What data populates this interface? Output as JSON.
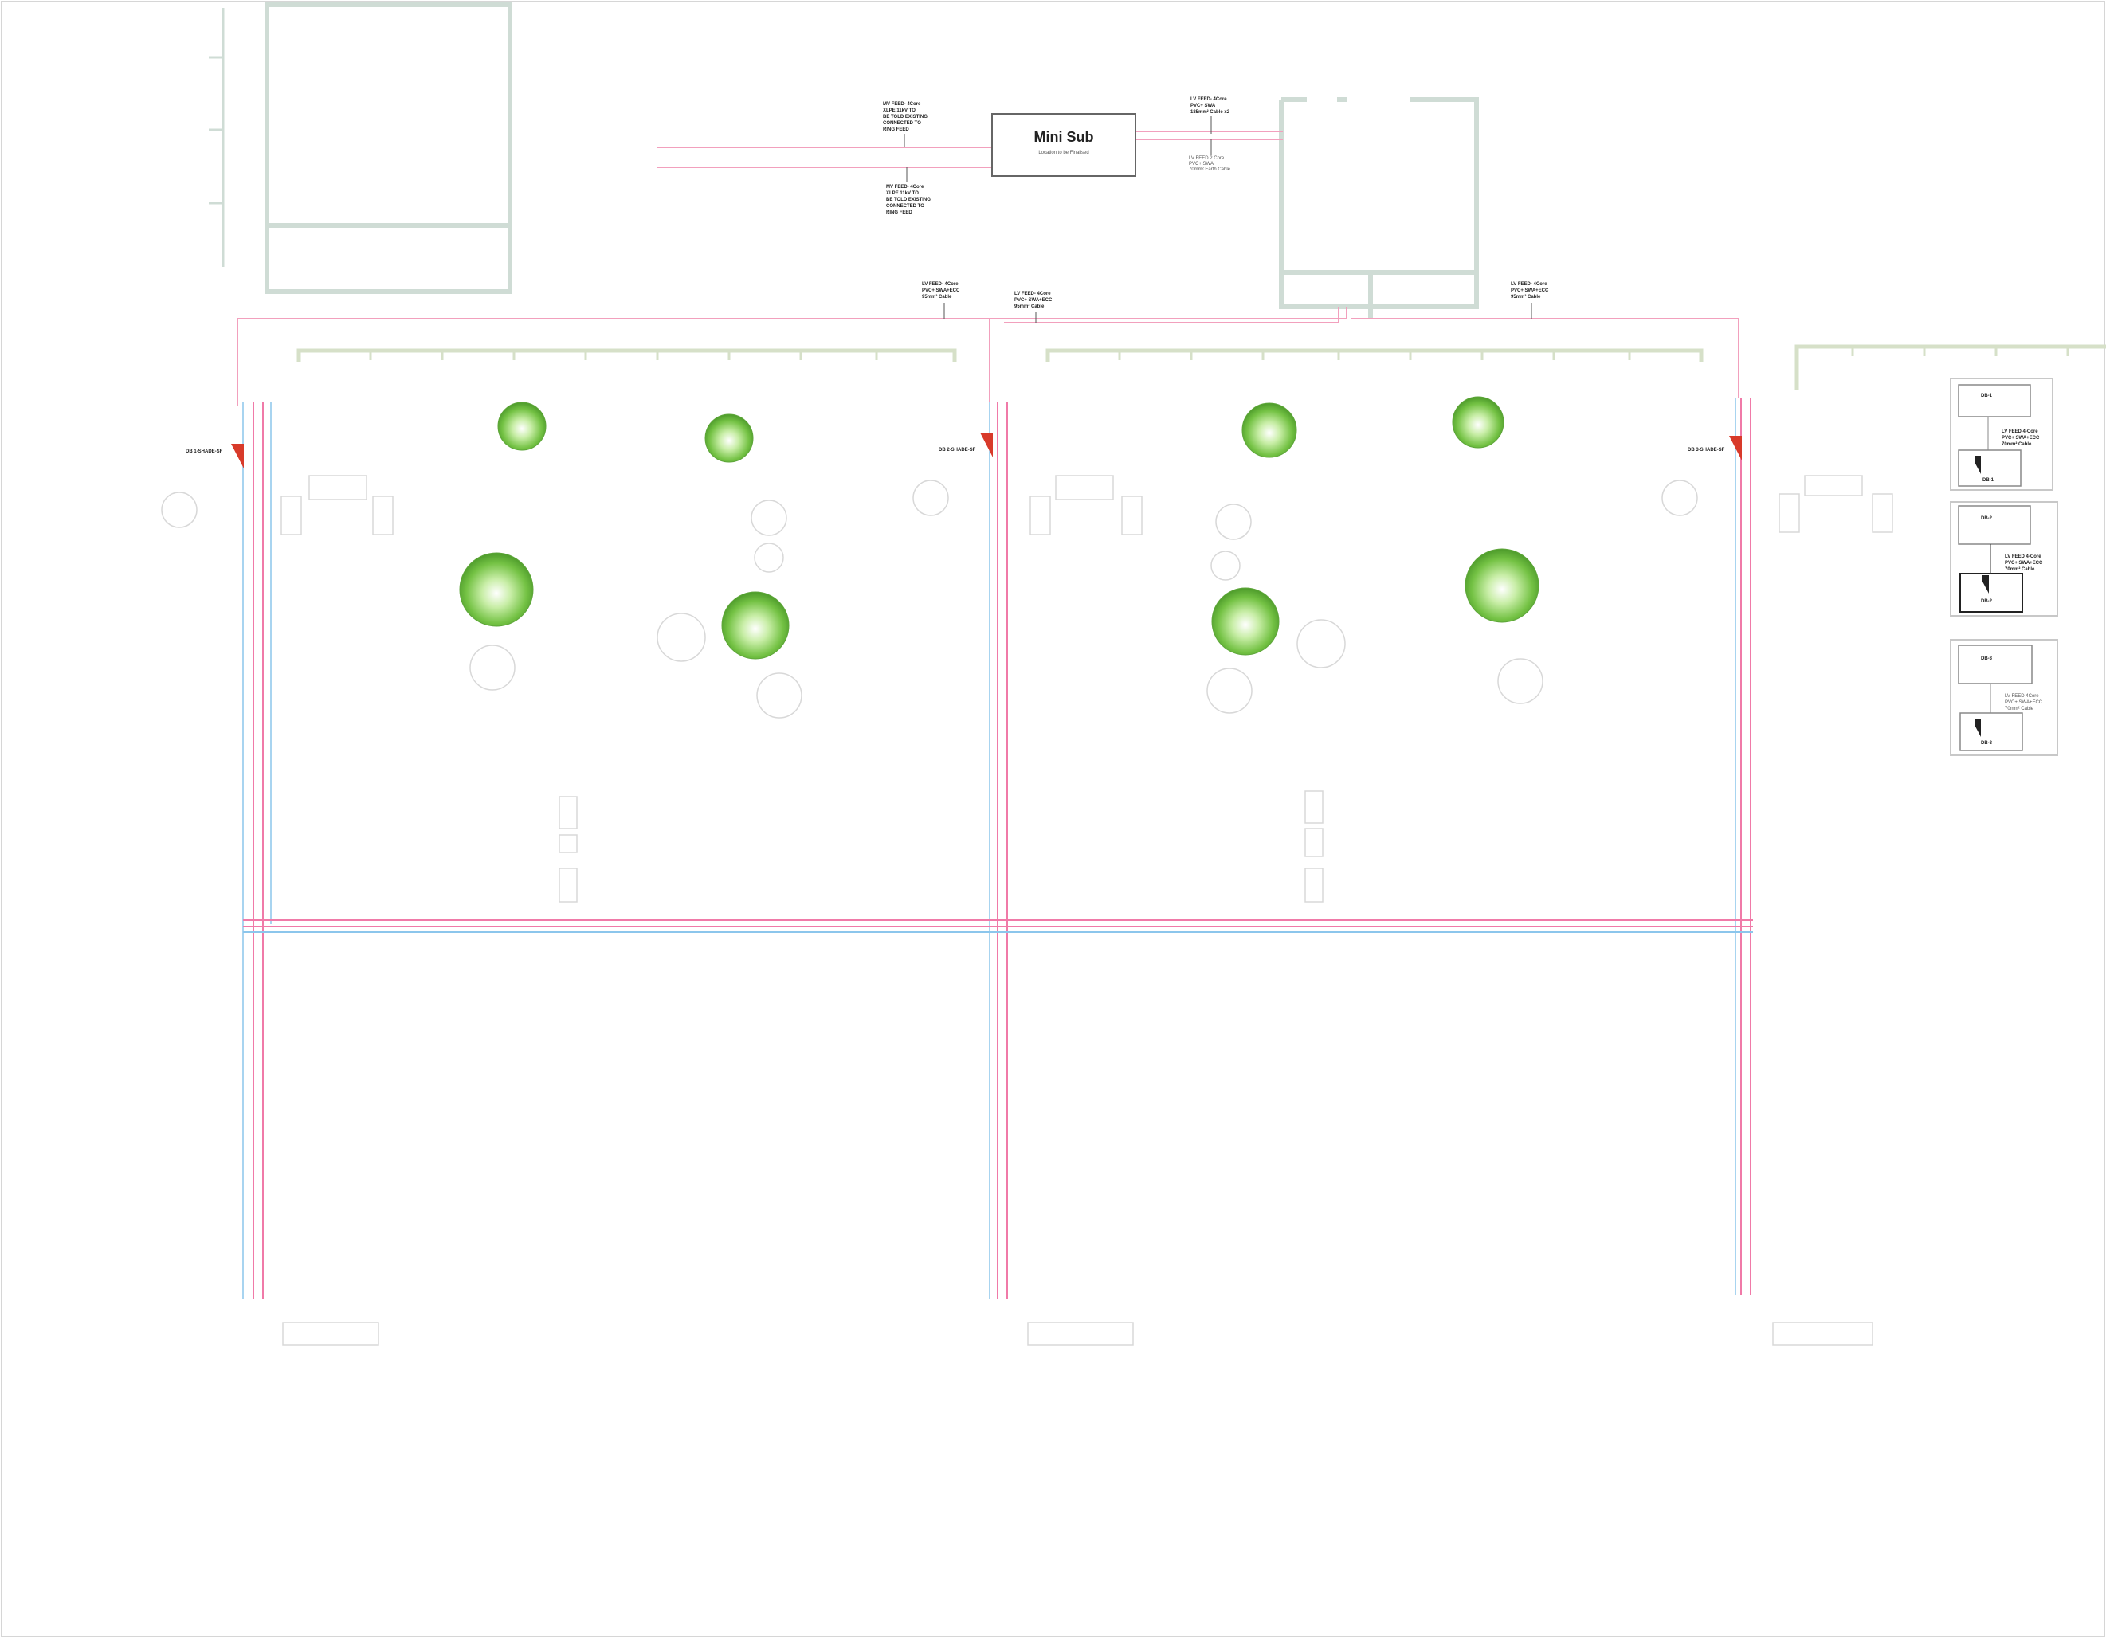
{
  "minisub": {
    "title": "Mini Sub",
    "subtitle": "Location to be Finalised"
  },
  "feeds": {
    "mv_incoming": [
      "MV FEED- 4Core",
      "XLPE 11kV TO",
      "BE TOLD EXISTING",
      "CONNECTED TO",
      "RING FEED"
    ],
    "mv_outgoing": [
      "MV FEED- 4Core",
      "XLPE 11kV TO",
      "BE TOLD EXISTING",
      "CONNECTED TO",
      "RING FEED"
    ],
    "lv_top": [
      "LV FEED- 4Core",
      "PVC+ SWA",
      "185mm² Cable x2"
    ],
    "lv_top_earth": [
      "LV FEED 2 Core",
      "PVC+ SWA",
      "70mm² Earth Cable"
    ],
    "lv_db1": [
      "LV FEED- 4Core",
      "PVC+ SWA+ECC",
      "95mm² Cable"
    ],
    "lv_db2": [
      "LV FEED- 4Core",
      "PVC+ SWA+ECC",
      "95mm² Cable"
    ],
    "lv_db3": [
      "LV FEED- 4Core",
      "PVC+ SWA+ECC",
      "95mm² Cable"
    ]
  },
  "dbs": {
    "db1": "DB 1-SHADE-SF",
    "db2": "DB 2-SHADE-SF",
    "db3": "DB 3-SHADE-SF"
  },
  "legend": {
    "box1": {
      "top": "DB-1",
      "bottom": "DB-1",
      "feed": [
        "LV FEED 4-Core",
        "PVC+ SWA+ECC",
        "70mm² Cable"
      ]
    },
    "box2": {
      "top": "DB-2",
      "bottom": "DB-2",
      "feed": [
        "LV FEED 4-Core",
        "PVC+ SWA+ECC",
        "70mm² Cable"
      ]
    },
    "box3": {
      "top": "DB-3",
      "bottom": "DB-3",
      "feed": [
        "LV FEED 4Core",
        "PVC+ SWA+ECC",
        "70mm² Cable"
      ]
    }
  },
  "colors": {
    "cable_mv": "#e85a8f",
    "cable_lv": "#f0a0c0",
    "earth": "#6fb8e8",
    "wall": "#c9d8d0",
    "db_marker": "#d83a2a",
    "tree": "#7ec850"
  }
}
